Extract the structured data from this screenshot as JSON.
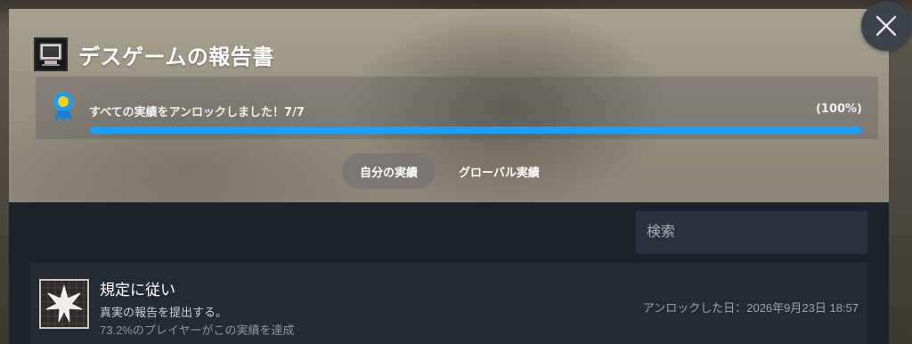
{
  "modal": {
    "game_title": "デスゲームの報告書",
    "game_icon": "computer-icon",
    "close_icon": "close-icon"
  },
  "progress": {
    "label": "すべての実績をアンロックしました！7/7",
    "percent_label": "(100%)",
    "fraction": 1.0,
    "accent_color": "#1a9fff"
  },
  "tabs": [
    {
      "label": "自分の実績",
      "active": true
    },
    {
      "label": "グローバル実績",
      "active": false
    }
  ],
  "search": {
    "placeholder": "検索",
    "value": ""
  },
  "achievements": [
    {
      "name": "規定に従い",
      "description": "真実の報告を提出する。",
      "global_percent": "73.2%のプレイヤーがこの実績を達成",
      "unlocked": "アンロックした日：2026年9月23日 18:57",
      "icon": "starburst-icon"
    }
  ]
}
